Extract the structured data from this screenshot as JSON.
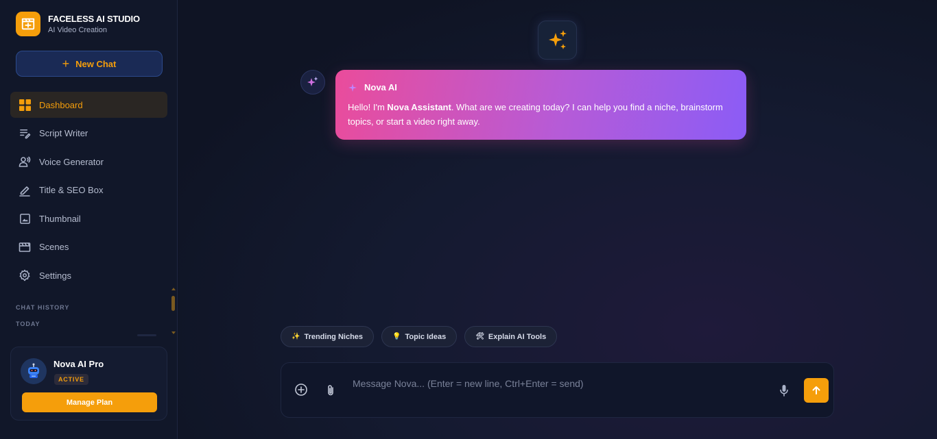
{
  "brand": {
    "title": "FACELESS AI STUDIO",
    "subtitle": "AI Video Creation",
    "icon": "clapperboard-icon"
  },
  "new_chat_label": "New Chat",
  "nav": [
    {
      "label": "Dashboard",
      "icon": "grid-icon",
      "active": true
    },
    {
      "label": "Script Writer",
      "icon": "script-icon",
      "active": false
    },
    {
      "label": "Voice Generator",
      "icon": "voice-icon",
      "active": false
    },
    {
      "label": "Title & SEO Box",
      "icon": "pen-icon",
      "active": false
    },
    {
      "label": "Thumbnail",
      "icon": "image-icon",
      "active": false
    },
    {
      "label": "Scenes",
      "icon": "clapper-icon",
      "active": false
    },
    {
      "label": "Settings",
      "icon": "gear-icon",
      "active": false
    }
  ],
  "history": {
    "heading": "CHAT HISTORY",
    "group": "TODAY"
  },
  "plan": {
    "name": "Nova AI Pro",
    "status": "ACTIVE",
    "button": "Manage Plan"
  },
  "chat": {
    "sender": "Nova AI",
    "message_prefix": "Hello! I'm ",
    "message_bold": "Nova Assistant",
    "message_suffix": ". What are we creating today? I can help you find a niche, brainstorm topics, or start a video right away."
  },
  "suggestions": [
    {
      "emoji": "✨",
      "label": "Trending Niches"
    },
    {
      "emoji": "💡",
      "label": "Topic Ideas"
    },
    {
      "emoji": "🛠",
      "label": "Explain AI Tools"
    }
  ],
  "composer": {
    "placeholder": "Message Nova... (Enter = new line, Ctrl+Enter = send)"
  },
  "colors": {
    "accent": "#f59e0b",
    "bubble_start": "#ea4c9b",
    "bubble_end": "#8b5cf6",
    "background": "#0f1424"
  }
}
